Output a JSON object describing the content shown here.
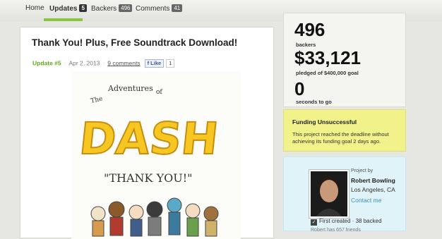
{
  "nav": {
    "home": "Home",
    "updates": {
      "label": "Updates",
      "count": "5"
    },
    "backers": {
      "label": "Backers",
      "count": "496"
    },
    "comments": {
      "label": "Comments",
      "count": "41"
    }
  },
  "post": {
    "title": "Thank You! Plus, Free Soundtrack Download!",
    "update_label": "Update #5",
    "date": "Apr 2, 2013",
    "comments": "9 comments",
    "like": "Like",
    "like_count": "1"
  },
  "artwork": {
    "top_text_the": "The",
    "top_text_adv": "Adventures",
    "top_text_of": "of",
    "logo": "DASH",
    "thank_you": "\"THANK YOU!\""
  },
  "stats": {
    "backers_value": "496",
    "backers_label": "backers",
    "pledged_value": "$33,121",
    "pledged_label": "pledged of $400,000 goal",
    "seconds_value": "0",
    "seconds_label": "seconds to go"
  },
  "alert": {
    "title": "Funding Unsuccessful",
    "text": "This project reached the deadline without achieving its funding goal 2 days ago."
  },
  "creator": {
    "label": "Project by",
    "name": "Robert Bowling",
    "location": "Los Angeles, CA",
    "contact": "Contact me",
    "first_created": "First created",
    "backed": "38 backed",
    "friends": "Robert has 657 friends"
  },
  "colors": {
    "accent_green": "#87c540",
    "alert_yellow": "#f1f28a",
    "creator_blue": "#dff3f8",
    "dash_yellow": "#f6c623"
  }
}
